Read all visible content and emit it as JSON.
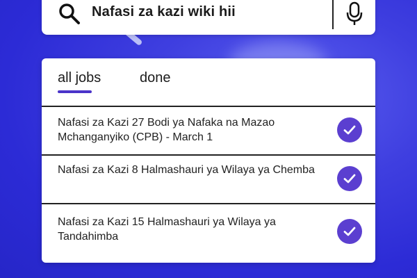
{
  "search": {
    "query": "Nafasi za kazi wiki hii"
  },
  "tabs": [
    {
      "label": "all jobs",
      "active": true
    },
    {
      "label": "done",
      "active": false
    }
  ],
  "jobs": [
    {
      "title": "Nafasi za Kazi 27 Bodi ya Nafaka na Mazao Mchanganyiko (CPB) - March 1",
      "done": true
    },
    {
      "title": "Nafasi za Kazi 8 Halmashauri ya Wilaya ya Chemba",
      "done": true
    },
    {
      "title": "Nafasi za Kazi 15 Halmashauri ya Wilaya ya Tandahimba",
      "done": true
    }
  ],
  "icons": {
    "search": "search-icon",
    "mic": "microphone-icon",
    "check": "check-circle-icon"
  },
  "colors": {
    "background": "#3f3fe0",
    "accent": "#5b3fd0",
    "card": "#ffffff"
  }
}
